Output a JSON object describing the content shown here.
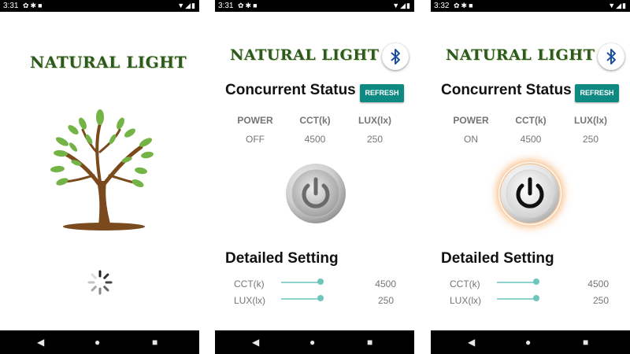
{
  "status_bar": {
    "times": [
      "3:31",
      "3:31",
      "3:32"
    ],
    "left_icons": "✿✱■",
    "right_icons": "▼◢▮"
  },
  "nav_bar": {
    "back_glyph": "◀",
    "home_glyph": "●",
    "recents_glyph": "■"
  },
  "splash": {
    "title": "NATURAL LIGHT"
  },
  "screens": [
    {
      "title": "NATURAL LIGHT",
      "concurrent_status_heading": "Concurrent Status",
      "refresh_label": "REFRESH",
      "columns": [
        "POWER",
        "CCT(k)",
        "LUX(lx)"
      ],
      "values": [
        "OFF",
        "4500",
        "250"
      ],
      "power_on": false,
      "detailed_setting_heading": "Detailed Setting",
      "sliders": [
        {
          "label": "CCT(k)",
          "value": "4500",
          "level": 1.0
        },
        {
          "label": "LUX(lx)",
          "value": "250",
          "level": 1.0
        }
      ]
    },
    {
      "title": "NATURAL LIGHT",
      "concurrent_status_heading": "Concurrent Status",
      "refresh_label": "REFRESH",
      "columns": [
        "POWER",
        "CCT(k)",
        "LUX(lx)"
      ],
      "values": [
        "ON",
        "4500",
        "250"
      ],
      "power_on": true,
      "detailed_setting_heading": "Detailed Setting",
      "sliders": [
        {
          "label": "CCT(k)",
          "value": "4500",
          "level": 1.0
        },
        {
          "label": "LUX(lx)",
          "value": "250",
          "level": 1.0
        }
      ]
    }
  ],
  "icons": {
    "bluetooth": "bluetooth-icon",
    "power": "power-icon",
    "tree": "tree-logo",
    "spinner": "loading-spinner-icon"
  },
  "colors": {
    "title_green": "#2c5a1c",
    "refresh_teal": "#0f8a83",
    "slider_teal": "#6fc4bb",
    "power_on_glow": "#f4b57a"
  }
}
